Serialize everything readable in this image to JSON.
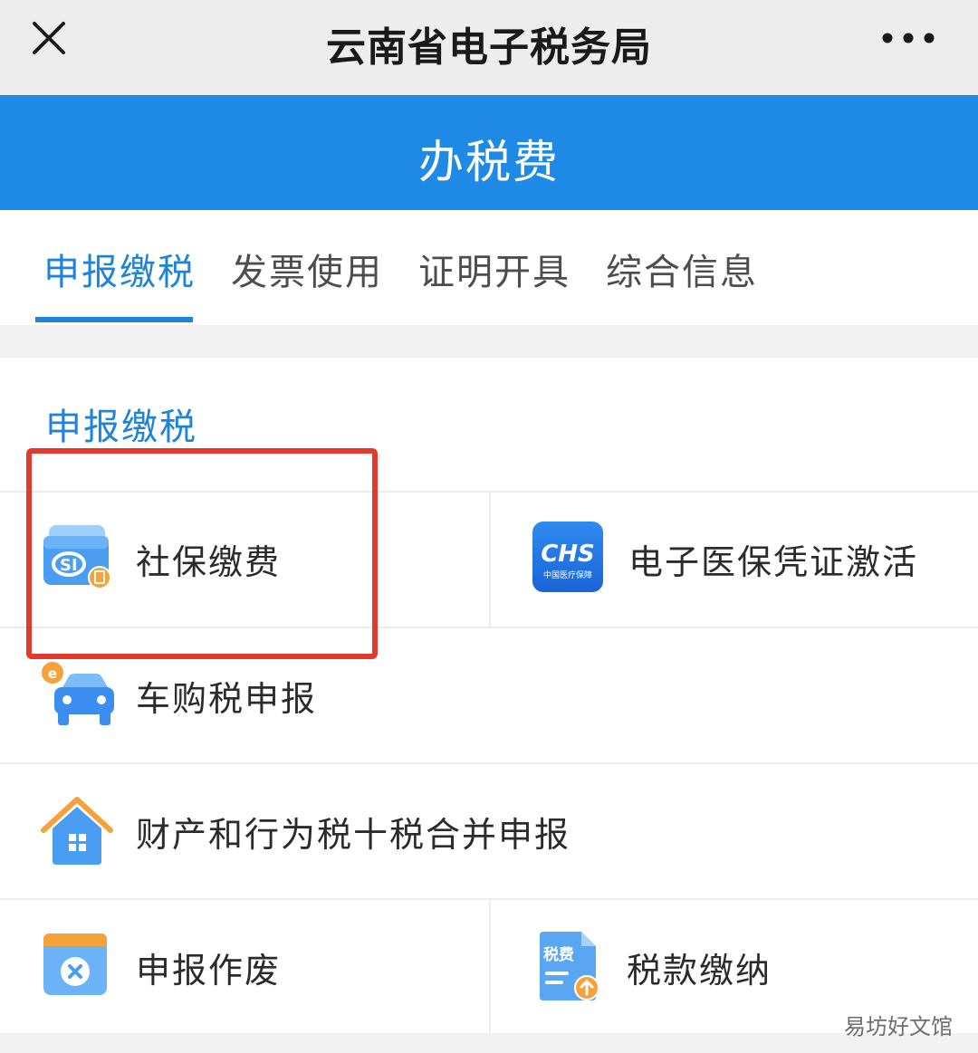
{
  "window": {
    "title": "云南省电子税务局"
  },
  "header": {
    "title": "办税费"
  },
  "tabs": [
    {
      "label": "申报缴税",
      "active": true
    },
    {
      "label": "发票使用",
      "active": false
    },
    {
      "label": "证明开具",
      "active": false
    },
    {
      "label": "综合信息",
      "active": false
    }
  ],
  "section": {
    "title": "申报缴税"
  },
  "items": [
    {
      "label": "社保缴费",
      "icon": "social-security-card-icon"
    },
    {
      "label": "电子医保凭证激活",
      "icon": "chs-medical-insurance-icon",
      "icon_text": "CHS",
      "icon_subtext": "中国医疗保障"
    },
    {
      "label": "车购税申报",
      "icon": "car-icon"
    },
    {
      "label": "财产和行为税十税合并申报",
      "icon": "house-icon"
    },
    {
      "label": "申报作废",
      "icon": "cancel-declaration-icon"
    },
    {
      "label": "税款缴纳",
      "icon": "tax-payment-icon",
      "icon_text": "税费"
    }
  ],
  "watermark": "易坊好文馆",
  "colors": {
    "accent": "#1f8ae5",
    "tab_active": "#1f83d8",
    "highlight_box": "#e23a2c"
  }
}
